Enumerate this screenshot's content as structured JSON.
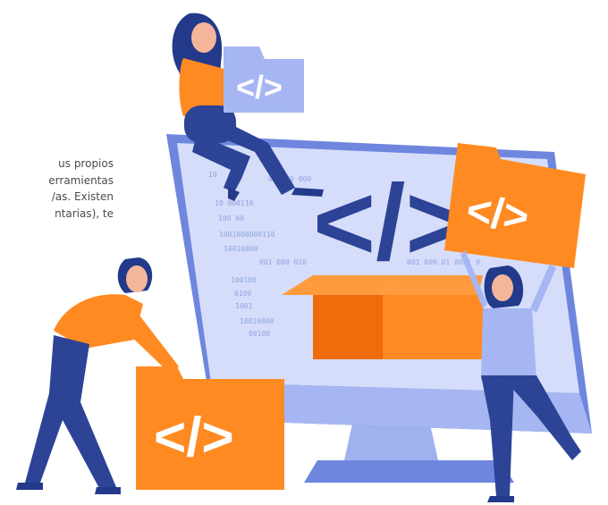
{
  "paragraph": {
    "lines": [
      "us propios",
      "erramientas",
      "/as. Existen",
      "ntarias),   te"
    ]
  },
  "screen": {
    "binary_lines": [
      {
        "text": "10",
        "color": "#8fa4e0"
      },
      {
        "text": "00      100      000",
        "color": "#8fa4e0"
      },
      {
        "text": "10     000110",
        "color": "#8fa4e0"
      },
      {
        "text": "100  00",
        "color": "#8fa4e0"
      },
      {
        "text": "1001000000110",
        "color": "#8fa4e0"
      },
      {
        "text": "10010000",
        "color": "#8fa4e0"
      },
      {
        "text": "001  000     010",
        "color": "#8fa4e0"
      },
      {
        "text": "100100",
        "color": "#8fa4e0"
      },
      {
        "text": "0100",
        "color": "#8fa4e0"
      },
      {
        "text": "1001",
        "color": "#8fa4e0"
      },
      {
        "text": "10010000",
        "color": "#8fa4e0"
      },
      {
        "text": "00100",
        "color": "#8fa4e0"
      }
    ],
    "big_code_symbol": "</>",
    "right_binary": "001   000   01       0001   0"
  },
  "folders": {
    "held_by_sitting_woman": "</>",
    "held_by_right_woman": "</>",
    "held_by_left_woman": "</>"
  },
  "colors": {
    "monitor_blue": "#bcc8f5",
    "monitor_dark": "#6f86de",
    "navy": "#2c4396",
    "orange": "#ff8a22",
    "orange_dark": "#f06b0c",
    "lavender": "#a6b6f2",
    "skin": "#f5b59b",
    "hair": "#233a8a"
  }
}
